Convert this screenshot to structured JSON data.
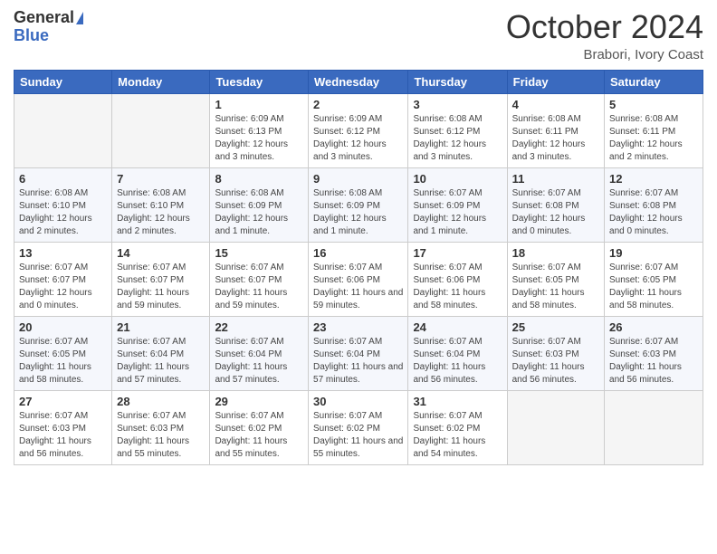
{
  "logo": {
    "general": "General",
    "blue": "Blue"
  },
  "title": "October 2024",
  "location": "Brabori, Ivory Coast",
  "days_of_week": [
    "Sunday",
    "Monday",
    "Tuesday",
    "Wednesday",
    "Thursday",
    "Friday",
    "Saturday"
  ],
  "weeks": [
    [
      {
        "day": "",
        "info": ""
      },
      {
        "day": "",
        "info": ""
      },
      {
        "day": "1",
        "info": "Sunrise: 6:09 AM\nSunset: 6:13 PM\nDaylight: 12 hours and 3 minutes."
      },
      {
        "day": "2",
        "info": "Sunrise: 6:09 AM\nSunset: 6:12 PM\nDaylight: 12 hours and 3 minutes."
      },
      {
        "day": "3",
        "info": "Sunrise: 6:08 AM\nSunset: 6:12 PM\nDaylight: 12 hours and 3 minutes."
      },
      {
        "day": "4",
        "info": "Sunrise: 6:08 AM\nSunset: 6:11 PM\nDaylight: 12 hours and 3 minutes."
      },
      {
        "day": "5",
        "info": "Sunrise: 6:08 AM\nSunset: 6:11 PM\nDaylight: 12 hours and 2 minutes."
      }
    ],
    [
      {
        "day": "6",
        "info": "Sunrise: 6:08 AM\nSunset: 6:10 PM\nDaylight: 12 hours and 2 minutes."
      },
      {
        "day": "7",
        "info": "Sunrise: 6:08 AM\nSunset: 6:10 PM\nDaylight: 12 hours and 2 minutes."
      },
      {
        "day": "8",
        "info": "Sunrise: 6:08 AM\nSunset: 6:09 PM\nDaylight: 12 hours and 1 minute."
      },
      {
        "day": "9",
        "info": "Sunrise: 6:08 AM\nSunset: 6:09 PM\nDaylight: 12 hours and 1 minute."
      },
      {
        "day": "10",
        "info": "Sunrise: 6:07 AM\nSunset: 6:09 PM\nDaylight: 12 hours and 1 minute."
      },
      {
        "day": "11",
        "info": "Sunrise: 6:07 AM\nSunset: 6:08 PM\nDaylight: 12 hours and 0 minutes."
      },
      {
        "day": "12",
        "info": "Sunrise: 6:07 AM\nSunset: 6:08 PM\nDaylight: 12 hours and 0 minutes."
      }
    ],
    [
      {
        "day": "13",
        "info": "Sunrise: 6:07 AM\nSunset: 6:07 PM\nDaylight: 12 hours and 0 minutes."
      },
      {
        "day": "14",
        "info": "Sunrise: 6:07 AM\nSunset: 6:07 PM\nDaylight: 11 hours and 59 minutes."
      },
      {
        "day": "15",
        "info": "Sunrise: 6:07 AM\nSunset: 6:07 PM\nDaylight: 11 hours and 59 minutes."
      },
      {
        "day": "16",
        "info": "Sunrise: 6:07 AM\nSunset: 6:06 PM\nDaylight: 11 hours and 59 minutes."
      },
      {
        "day": "17",
        "info": "Sunrise: 6:07 AM\nSunset: 6:06 PM\nDaylight: 11 hours and 58 minutes."
      },
      {
        "day": "18",
        "info": "Sunrise: 6:07 AM\nSunset: 6:05 PM\nDaylight: 11 hours and 58 minutes."
      },
      {
        "day": "19",
        "info": "Sunrise: 6:07 AM\nSunset: 6:05 PM\nDaylight: 11 hours and 58 minutes."
      }
    ],
    [
      {
        "day": "20",
        "info": "Sunrise: 6:07 AM\nSunset: 6:05 PM\nDaylight: 11 hours and 58 minutes."
      },
      {
        "day": "21",
        "info": "Sunrise: 6:07 AM\nSunset: 6:04 PM\nDaylight: 11 hours and 57 minutes."
      },
      {
        "day": "22",
        "info": "Sunrise: 6:07 AM\nSunset: 6:04 PM\nDaylight: 11 hours and 57 minutes."
      },
      {
        "day": "23",
        "info": "Sunrise: 6:07 AM\nSunset: 6:04 PM\nDaylight: 11 hours and 57 minutes."
      },
      {
        "day": "24",
        "info": "Sunrise: 6:07 AM\nSunset: 6:04 PM\nDaylight: 11 hours and 56 minutes."
      },
      {
        "day": "25",
        "info": "Sunrise: 6:07 AM\nSunset: 6:03 PM\nDaylight: 11 hours and 56 minutes."
      },
      {
        "day": "26",
        "info": "Sunrise: 6:07 AM\nSunset: 6:03 PM\nDaylight: 11 hours and 56 minutes."
      }
    ],
    [
      {
        "day": "27",
        "info": "Sunrise: 6:07 AM\nSunset: 6:03 PM\nDaylight: 11 hours and 56 minutes."
      },
      {
        "day": "28",
        "info": "Sunrise: 6:07 AM\nSunset: 6:03 PM\nDaylight: 11 hours and 55 minutes."
      },
      {
        "day": "29",
        "info": "Sunrise: 6:07 AM\nSunset: 6:02 PM\nDaylight: 11 hours and 55 minutes."
      },
      {
        "day": "30",
        "info": "Sunrise: 6:07 AM\nSunset: 6:02 PM\nDaylight: 11 hours and 55 minutes."
      },
      {
        "day": "31",
        "info": "Sunrise: 6:07 AM\nSunset: 6:02 PM\nDaylight: 11 hours and 54 minutes."
      },
      {
        "day": "",
        "info": ""
      },
      {
        "day": "",
        "info": ""
      }
    ]
  ]
}
